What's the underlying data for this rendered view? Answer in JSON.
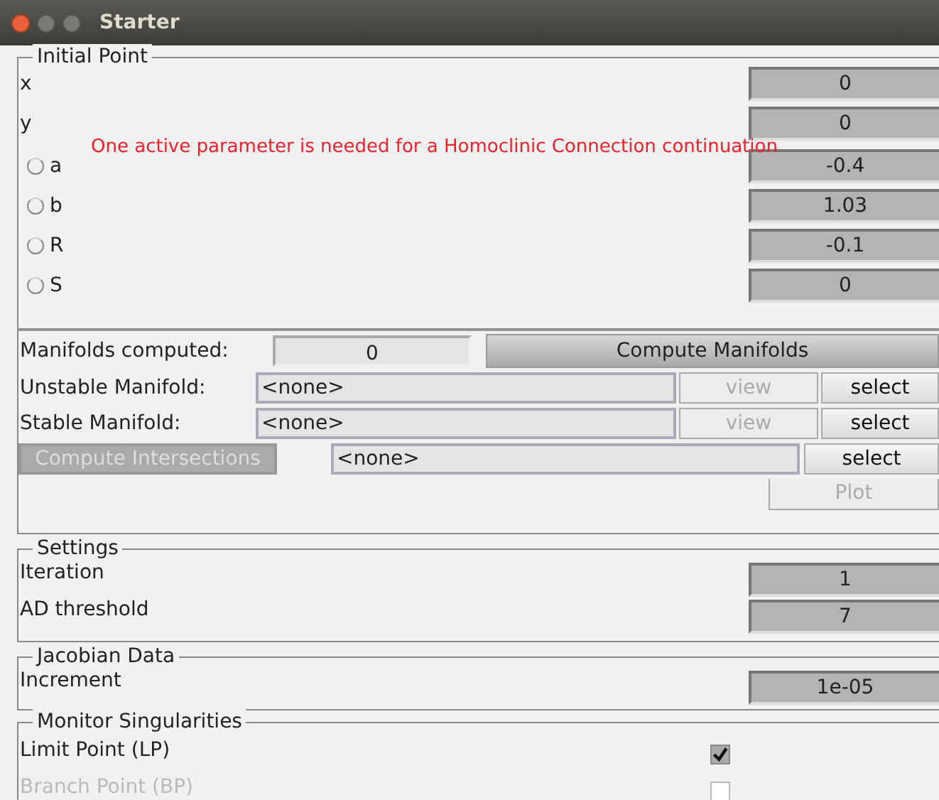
{
  "window": {
    "title": "Starter"
  },
  "initial_point": {
    "title": "Initial Point",
    "variables": [
      {
        "label": "x",
        "value": "0"
      },
      {
        "label": "y",
        "value": "0"
      }
    ],
    "warning": "One active parameter is needed for a Homoclinic Connection continuation",
    "parameters": [
      {
        "label": "a",
        "value": "-0.4",
        "selected": false
      },
      {
        "label": "b",
        "value": "1.03",
        "selected": false
      },
      {
        "label": "R",
        "value": "-0.1",
        "selected": false
      },
      {
        "label": "S",
        "value": "0",
        "selected": false
      }
    ]
  },
  "manifolds": {
    "computed_label": "Manifolds computed:",
    "computed_value": "0",
    "compute_button": "Compute Manifolds",
    "rows": [
      {
        "label": "Unstable Manifold:",
        "value": "<none>",
        "view": "view",
        "view_disabled": true,
        "select": "select"
      },
      {
        "label": "Stable Manifold:",
        "value": "<none>",
        "view": "view",
        "view_disabled": true,
        "select": "select"
      }
    ],
    "intersections": {
      "button": "Compute Intersections",
      "disabled": true,
      "value": "<none>",
      "select": "select",
      "plot": "Plot",
      "plot_disabled": true
    }
  },
  "settings": {
    "title": "Settings",
    "rows": [
      {
        "label": "Iteration",
        "value": "1"
      },
      {
        "label": "AD threshold",
        "value": "7"
      }
    ]
  },
  "jacobian": {
    "title": "Jacobian Data",
    "rows": [
      {
        "label": "Increment",
        "value": "1e-05"
      }
    ]
  },
  "monitor": {
    "title": "Monitor Singularities",
    "items": [
      {
        "label": "Limit Point (LP)",
        "checked": true,
        "disabled": false
      },
      {
        "label": "Branch Point (BP)",
        "checked": false,
        "disabled": true
      }
    ]
  }
}
